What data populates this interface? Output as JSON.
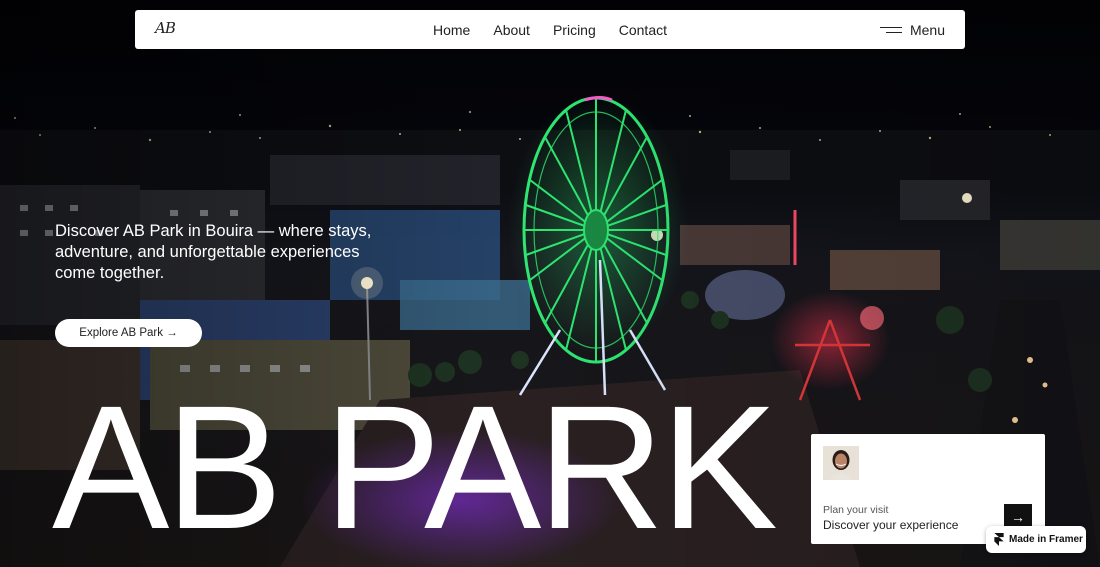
{
  "nav": {
    "logo": "AB",
    "links": [
      "Home",
      "About",
      "Pricing",
      "Contact"
    ],
    "menu_label": "Menu"
  },
  "hero": {
    "tagline": "Discover AB Park in Bouira — where stays, adventure, and unforgettable experiences come together.",
    "cta_label": "Explore AB Park →",
    "title": "AB PARK"
  },
  "plan_card": {
    "kicker": "Plan your visit",
    "title": "Discover your experience",
    "arrow": "→"
  },
  "badge": {
    "label": "Made in Framer"
  },
  "icons": {
    "menu": "menu-icon",
    "arrow": "arrow-right-icon",
    "framer": "framer-logo-icon"
  },
  "colors": {
    "background": "#05060a",
    "ferris_wheel": "#2ee872",
    "nav_bg": "#ffffff",
    "button_dark": "#111111"
  }
}
